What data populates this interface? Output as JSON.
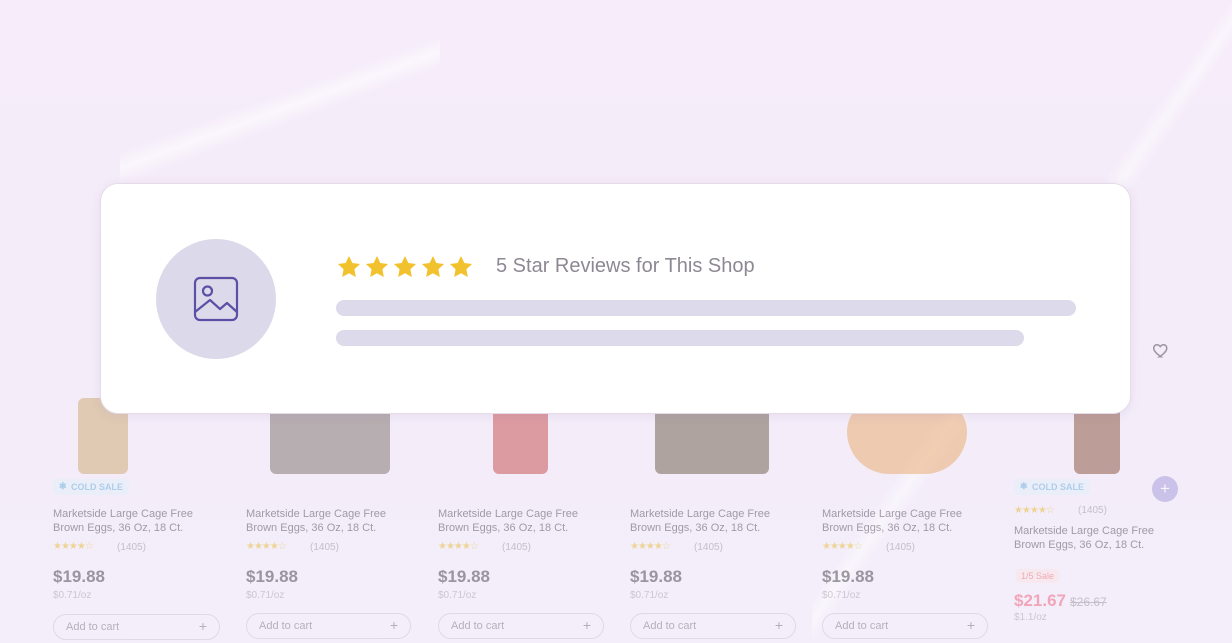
{
  "review_card": {
    "stars": 5,
    "title": "5 Star Reviews for This Shop",
    "star_color": "#f2c22e",
    "accent_color": "#5b4fa6"
  },
  "products": [
    {
      "badge": "COLD SALE",
      "name": "Marketside Large Cage Free Brown Eggs, 36 Oz, 18 Ct.",
      "stars": "★★★★☆",
      "count": "(1405)",
      "price": "$19.88",
      "unit": "$0.71/oz",
      "cart": "Add to cart",
      "thumb_color": "#c9a060"
    },
    {
      "badge": "",
      "name": "Marketside Large Cage Free Brown Eggs, 36 Oz, 18 Ct.",
      "stars": "★★★★☆",
      "count": "(1405)",
      "price": "$19.88",
      "unit": "$0.71/oz",
      "cart": "Add to cart",
      "thumb_color": "#6d6358"
    },
    {
      "badge": "",
      "name": "Marketside Large Cage Free Brown Eggs, 36 Oz, 18 Ct.",
      "stars": "★★★★☆",
      "count": "(1405)",
      "price": "$19.88",
      "unit": "$0.71/oz",
      "cart": "Add to cart",
      "thumb_color": "#c23a38"
    },
    {
      "badge": "",
      "name": "Marketside Large Cage Free Brown Eggs, 36 Oz, 18 Ct.",
      "stars": "★★★★☆",
      "count": "(1405)",
      "price": "$19.88",
      "unit": "$0.71/oz",
      "cart": "Add to cart",
      "thumb_color": "#5a4a34"
    },
    {
      "badge": "",
      "name": "Marketside Large Cage Free Brown Eggs, 36 Oz, 18 Ct.",
      "stars": "★★★★☆",
      "count": "(1405)",
      "price": "$19.88",
      "unit": "$0.71/oz",
      "cart": "Add to cart",
      "thumb_color": "#e8a15c"
    },
    {
      "badge": "COLD SALE",
      "name": "Marketside Large Cage Free Brown Eggs, 36 Oz, 18 Ct.",
      "stars": "★★★★☆",
      "count": "(1405)",
      "sale_tag": "1/5 Sale",
      "sale_price": "$21.67",
      "old_price": "$26.67",
      "unit": "$1.1/oz",
      "thumb_color": "#7a3e22"
    }
  ]
}
